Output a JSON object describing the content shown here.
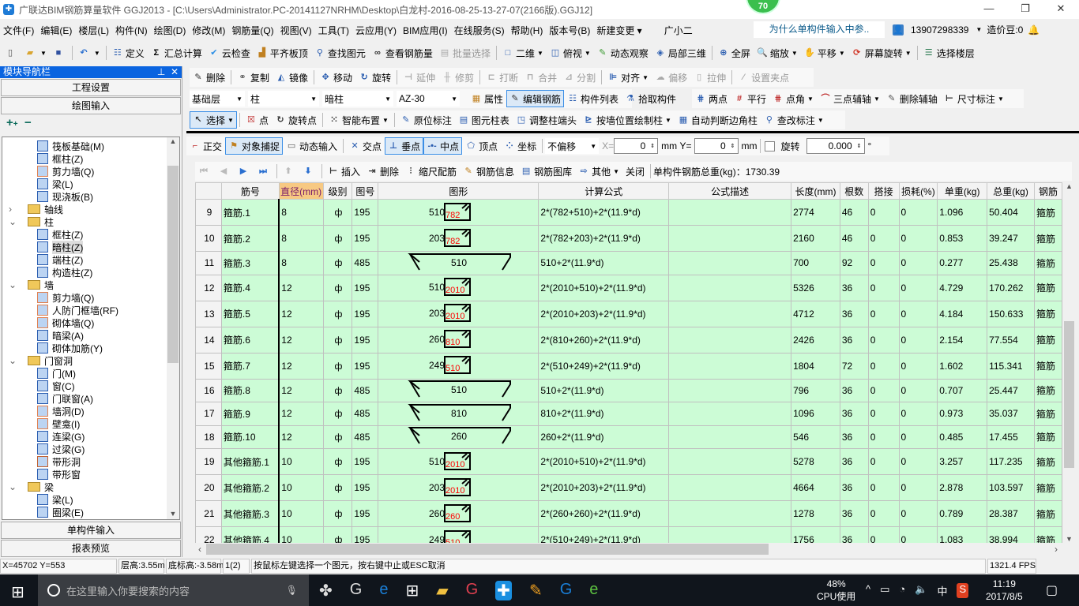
{
  "window": {
    "title": "广联达BIM钢筋算量软件 GGJ2013 - [C:\\Users\\Administrator.PC-20141127NRHM\\Desktop\\白龙村-2016-08-25-13-27-07(2166版).GGJ12]",
    "badge": "70",
    "minimize": "—",
    "restore": "❐",
    "close": "✕"
  },
  "menu": {
    "items": [
      "文件(F)",
      "编辑(E)",
      "楼层(L)",
      "构件(N)",
      "绘图(D)",
      "修改(M)",
      "钢筋量(Q)",
      "视图(V)",
      "工具(T)",
      "云应用(Y)",
      "BIM应用(I)",
      "在线服务(S)",
      "帮助(H)",
      "版本号(B)",
      "新建变更 ▾",
      "广小二"
    ],
    "question": "为什么单构件输入中参..",
    "user": "13907298339",
    "beans": "造价豆:0"
  },
  "toolbar1": [
    {
      "icon": "new-file",
      "g": "▯",
      "c": "#555"
    },
    {
      "icon": "open-folder",
      "g": "▰",
      "c": "#d9a530",
      "dd": true
    },
    {
      "icon": "save",
      "g": "■",
      "c": "#3050a0"
    },
    {
      "sep": true
    },
    {
      "icon": "undo",
      "g": "↶",
      "c": "#2a6fd0",
      "dd": true
    },
    {
      "sep": true
    },
    {
      "icon": "define",
      "g": "☷",
      "c": "#2a5db0",
      "label": "定义"
    },
    {
      "icon": "sigma",
      "g": "Σ",
      "c": "#000",
      "label": "汇总计算"
    },
    {
      "icon": "cloud-check",
      "g": "✔",
      "c": "#2a8ee6",
      "label": "云检查"
    },
    {
      "icon": "align-slab",
      "g": "▟",
      "c": "#c08020",
      "label": "平齐板顶"
    },
    {
      "icon": "binoculars",
      "g": "⚲",
      "c": "#2a5db0",
      "label": "查找图元"
    },
    {
      "icon": "glasses",
      "g": "∞",
      "c": "#333",
      "label": "查看钢筋量"
    },
    {
      "icon": "batch-select",
      "g": "▤",
      "c": "#aaa",
      "label": "批量选择",
      "dis": true
    },
    {
      "sep": true
    },
    {
      "icon": "view-2d",
      "g": "□",
      "c": "#2a5db0",
      "label": "二维",
      "dd": true
    },
    {
      "icon": "top-view",
      "g": "◫",
      "c": "#2a5db0",
      "label": "俯视",
      "dd": true
    },
    {
      "icon": "dynamic-observe",
      "g": "✎",
      "c": "#3a9a30",
      "label": "动态观察"
    },
    {
      "icon": "partial-3d",
      "g": "◈",
      "c": "#2a5db0",
      "label": "局部三维"
    },
    {
      "sep": true
    },
    {
      "icon": "fullscreen",
      "g": "⊕",
      "c": "#2a5db0",
      "label": "全屏"
    },
    {
      "icon": "zoom",
      "g": "🔍",
      "c": "#2a5db0",
      "label": "缩放",
      "dd": true
    },
    {
      "icon": "pan",
      "g": "✋",
      "c": "#c08020",
      "label": "平移",
      "dd": true
    },
    {
      "icon": "rotate-screen",
      "g": "⟳",
      "c": "#d03020",
      "label": "屏幕旋转",
      "dd": true
    },
    {
      "sep": true
    },
    {
      "icon": "select-floor",
      "g": "☰",
      "c": "#2a7a50",
      "label": "选择楼层"
    }
  ],
  "toolbar2": [
    {
      "icon": "delete",
      "g": "✎",
      "c": "#333",
      "label": "删除"
    },
    {
      "sep": true
    },
    {
      "icon": "copy",
      "g": "⚭",
      "c": "#555",
      "label": "复制"
    },
    {
      "icon": "mirror",
      "g": "◭",
      "c": "#2a5db0",
      "label": "镜像"
    },
    {
      "sep": true
    },
    {
      "icon": "move",
      "g": "✥",
      "c": "#2a5db0",
      "label": "移动"
    },
    {
      "icon": "rotate",
      "g": "↻",
      "c": "#2a5db0",
      "label": "旋转"
    },
    {
      "sep": true
    },
    {
      "icon": "extend",
      "g": "⊣",
      "c": "#aaa",
      "label": "延伸",
      "dis": true
    },
    {
      "icon": "trim",
      "g": "╫",
      "c": "#aaa",
      "label": "修剪",
      "dis": true
    },
    {
      "sep": true
    },
    {
      "icon": "break",
      "g": "⊏",
      "c": "#aaa",
      "label": "打断",
      "dis": true
    },
    {
      "icon": "merge",
      "g": "⊓",
      "c": "#aaa",
      "label": "合并",
      "dis": true
    },
    {
      "icon": "split",
      "g": "⊿",
      "c": "#aaa",
      "label": "分割",
      "dis": true
    },
    {
      "sep": true
    },
    {
      "icon": "align",
      "g": "⊫",
      "c": "#2a5db0",
      "label": "对齐",
      "dd": true
    },
    {
      "icon": "offset",
      "g": "☁",
      "c": "#aaa",
      "label": "偏移",
      "dis": true
    },
    {
      "icon": "stretch",
      "g": "▯",
      "c": "#aaa",
      "label": "拉伸",
      "dis": true
    },
    {
      "sep": true
    },
    {
      "icon": "set-grip",
      "g": "⁄",
      "c": "#aaa",
      "label": "设置夹点",
      "dis": true
    }
  ],
  "toolbar3": {
    "combos": [
      "基础层",
      "柱",
      "暗柱",
      "AZ-30"
    ],
    "items": [
      {
        "icon": "properties",
        "g": "▦",
        "c": "#c08020",
        "label": "属性"
      },
      {
        "icon": "edit-rebar",
        "g": "✎",
        "c": "#333",
        "label": "编辑钢筋",
        "active": true
      },
      {
        "icon": "component-list",
        "g": "☷",
        "c": "#2a5db0",
        "label": "构件列表"
      },
      {
        "icon": "pick-component",
        "g": "⚗",
        "c": "#2a5db0",
        "label": "拾取构件"
      }
    ]
  },
  "toolbar3b": [
    {
      "icon": "two-point-axis",
      "g": "⋕",
      "c": "#2a5db0",
      "label": "两点"
    },
    {
      "icon": "parallel-axis",
      "g": "#",
      "c": "#c03030",
      "label": "平行"
    },
    {
      "icon": "point-angle-axis",
      "g": "⋕",
      "c": "#c03030",
      "label": "点角",
      "dd": true
    },
    {
      "icon": "three-point-axis",
      "g": "⌒",
      "c": "#c03030",
      "label": "三点辅轴",
      "dd": true
    },
    {
      "icon": "delete-axis",
      "g": "✎",
      "c": "#555",
      "label": "删除辅轴"
    },
    {
      "icon": "dimension",
      "g": "⊢",
      "c": "#333",
      "label": "尺寸标注",
      "dd": true
    }
  ],
  "toolbar4": [
    {
      "icon": "select-cursor",
      "g": "↖",
      "c": "#333",
      "label": "选择",
      "active": true,
      "dd": true
    },
    {
      "sep": true
    },
    {
      "icon": "point",
      "g": "☒",
      "c": "#c03030",
      "label": "点"
    },
    {
      "icon": "rotate-point",
      "g": "↻",
      "c": "#333",
      "label": "旋转点"
    },
    {
      "sep": true
    },
    {
      "icon": "smart-layout",
      "g": "⁙",
      "c": "#333",
      "label": "智能布置",
      "dd": true
    },
    {
      "sep": true
    },
    {
      "icon": "in-situ-annotation",
      "g": "✎",
      "c": "#2a5db0",
      "label": "原位标注"
    },
    {
      "icon": "column-table",
      "g": "▤",
      "c": "#2a5db0",
      "label": "图元柱表"
    },
    {
      "icon": "adjust-column-end",
      "g": "◳",
      "c": "#2a5db0",
      "label": "调整柱端头"
    },
    {
      "icon": "draw-by-wall",
      "g": "⊵",
      "c": "#2a5db0",
      "label": "按墙位置绘制柱",
      "dd": true
    },
    {
      "icon": "auto-corner-column",
      "g": "▦",
      "c": "#2a5db0",
      "label": "自动判断边角柱"
    },
    {
      "icon": "modify-annotation",
      "g": "⚲",
      "c": "#2a5db0",
      "label": "查改标注",
      "dd": true
    }
  ],
  "toolbar5": {
    "items": [
      {
        "icon": "orthogonal",
        "g": "⌐",
        "c": "#c03030",
        "label": "正交"
      },
      {
        "icon": "object-snap",
        "g": "⚑",
        "c": "#c08020",
        "label": "对象捕捉",
        "active": true
      },
      {
        "icon": "dynamic-input",
        "g": "▭",
        "c": "#555",
        "label": "动态输入"
      },
      {
        "sep": true
      },
      {
        "icon": "intersection",
        "g": "✕",
        "c": "#2a5db0",
        "label": "交点"
      },
      {
        "icon": "perpendicular",
        "g": "⊥",
        "c": "#2a5db0",
        "label": "垂点",
        "active": true
      },
      {
        "icon": "midpoint",
        "g": "-•-",
        "c": "#2a5db0",
        "label": "中点",
        "active": true
      },
      {
        "icon": "vertex",
        "g": "⬠",
        "c": "#2a5db0",
        "label": "顶点"
      },
      {
        "icon": "coordinate",
        "g": "⁘",
        "c": "#2a5db0",
        "label": "坐标"
      }
    ],
    "offset": "不偏移",
    "x_label": "X=",
    "x_value": "0",
    "unit": "mm",
    "y_label": "Y=",
    "y_value": "0",
    "rotate_label": "旋转",
    "rotate_value": "0.000",
    "degree": "°"
  },
  "rebar_toolbar": {
    "items": [
      {
        "icon": "first",
        "g": "⏮",
        "c": "#bbb"
      },
      {
        "icon": "prev",
        "g": "◀",
        "c": "#bbb"
      },
      {
        "icon": "next",
        "g": "▶",
        "c": "#2a6fd0"
      },
      {
        "icon": "last",
        "g": "⏭",
        "c": "#2a6fd0"
      },
      {
        "sep": true
      },
      {
        "icon": "move-up",
        "g": "⬆",
        "c": "#bbb"
      },
      {
        "icon": "move-down",
        "g": "⬇",
        "c": "#2a6fd0"
      },
      {
        "sep": true
      },
      {
        "icon": "insert",
        "g": "⊢",
        "c": "#333",
        "label": "插入"
      },
      {
        "icon": "delete-row",
        "g": "⇥",
        "c": "#333",
        "label": "删除"
      },
      {
        "icon": "scale-rebar",
        "g": "⫶",
        "c": "#333",
        "label": "缩尺配筋"
      },
      {
        "icon": "rebar-info",
        "g": "✎",
        "c": "#c08020",
        "label": "钢筋信息"
      },
      {
        "icon": "rebar-library",
        "g": "▤",
        "c": "#2a5db0",
        "label": "钢筋图库"
      },
      {
        "icon": "other",
        "g": "⇨",
        "c": "#2a5db0",
        "label": "其他",
        "dd": true
      },
      {
        "label": "关闭"
      },
      {
        "sep": true
      }
    ],
    "total_label": "单构件钢筋总重(kg)：1730.39"
  },
  "nav": {
    "title": "模块导航栏",
    "pin": "⊥",
    "close": "✕",
    "top_buttons": [
      "工程设置",
      "绘图输入"
    ],
    "bottom_buttons": [
      "单构件输入",
      "报表预览"
    ],
    "expand": "+",
    "collapse": "−",
    "tree": [
      {
        "level": 2,
        "label": "筏板基础(M)",
        "icon": "raft-foundation",
        "c": "#2a5db0"
      },
      {
        "level": 2,
        "label": "框柱(Z)",
        "icon": "frame-column",
        "c": "#2a5db0"
      },
      {
        "level": 2,
        "label": "剪力墙(Q)",
        "icon": "shear-wall",
        "c": "#e08050"
      },
      {
        "level": 2,
        "label": "梁(L)",
        "icon": "beam",
        "c": "#2a5db0"
      },
      {
        "level": 2,
        "label": "现浇板(B)",
        "icon": "cast-slab",
        "c": "#2a5db0"
      },
      {
        "level": 1,
        "label": "轴线",
        "folder": true,
        "arrow": "›"
      },
      {
        "level": 1,
        "label": "柱",
        "folder": true,
        "arrow": "⌄"
      },
      {
        "level": 2,
        "label": "框柱(Z)",
        "icon": "frame-column",
        "c": "#2a5db0"
      },
      {
        "level": 2,
        "label": "暗柱(Z)",
        "icon": "hidden-column",
        "c": "#2a5db0",
        "selected": true
      },
      {
        "level": 2,
        "label": "端柱(Z)",
        "icon": "end-column",
        "c": "#2a5db0"
      },
      {
        "level": 2,
        "label": "构造柱(Z)",
        "icon": "constructional-column",
        "c": "#2a5db0"
      },
      {
        "level": 1,
        "label": "墙",
        "folder": true,
        "arrow": "⌄"
      },
      {
        "level": 2,
        "label": "剪力墙(Q)",
        "icon": "shear-wall",
        "c": "#e08050"
      },
      {
        "level": 2,
        "label": "人防门框墙(RF)",
        "icon": "civil-defense-wall",
        "c": "#e08050"
      },
      {
        "level": 2,
        "label": "砌体墙(Q)",
        "icon": "masonry-wall",
        "c": "#e08050"
      },
      {
        "level": 2,
        "label": "暗梁(A)",
        "icon": "hidden-beam",
        "c": "#2a5db0"
      },
      {
        "level": 2,
        "label": "砌体加筋(Y)",
        "icon": "masonry-rebar",
        "c": "#2a5db0"
      },
      {
        "level": 1,
        "label": "门窗洞",
        "folder": true,
        "arrow": "⌄"
      },
      {
        "level": 2,
        "label": "门(M)",
        "icon": "door",
        "c": "#2a5db0"
      },
      {
        "level": 2,
        "label": "窗(C)",
        "icon": "window",
        "c": "#2a5db0"
      },
      {
        "level": 2,
        "label": "门联窗(A)",
        "icon": "door-window",
        "c": "#2a5db0"
      },
      {
        "level": 2,
        "label": "墙洞(D)",
        "icon": "wall-hole",
        "c": "#e08050"
      },
      {
        "level": 2,
        "label": "壁龛(I)",
        "icon": "niche",
        "c": "#e08050"
      },
      {
        "level": 2,
        "label": "连梁(G)",
        "icon": "coupling-beam",
        "c": "#2a5db0"
      },
      {
        "level": 2,
        "label": "过梁(G)",
        "icon": "lintel",
        "c": "#2a5db0"
      },
      {
        "level": 2,
        "label": "带形洞",
        "icon": "strip-hole",
        "c": "#c06030"
      },
      {
        "level": 2,
        "label": "带形窗",
        "icon": "strip-window",
        "c": "#2a5db0"
      },
      {
        "level": 1,
        "label": "梁",
        "folder": true,
        "arrow": "⌄"
      },
      {
        "level": 2,
        "label": "梁(L)",
        "icon": "beam",
        "c": "#2a5db0"
      },
      {
        "level": 2,
        "label": "圈梁(E)",
        "icon": "ring-beam",
        "c": "#2a5db0"
      }
    ]
  },
  "table": {
    "headers": [
      "",
      "筋号",
      "直径(mm)",
      "级别",
      "图号",
      "图形",
      "计算公式",
      "公式描述",
      "长度(mm)",
      "根数",
      "搭接",
      "损耗(%)",
      "单重(kg)",
      "总重(kg)",
      "钢筋"
    ],
    "grade_symbol": "ф",
    "rows": [
      {
        "n": "9",
        "name": "箍筋.1",
        "d": "8",
        "fig": "195",
        "s1": "510",
        "s2": "782",
        "formula": "2*(782+510)+2*(11.9*d)",
        "len": "2774",
        "cnt": "46",
        "lap": "0",
        "loss": "0",
        "uw": "1.096",
        "tw": "50.404",
        "type": "箍筋"
      },
      {
        "n": "10",
        "name": "箍筋.2",
        "d": "8",
        "fig": "195",
        "s1": "203",
        "s2": "782",
        "formula": "2*(782+203)+2*(11.9*d)",
        "len": "2160",
        "cnt": "46",
        "lap": "0",
        "loss": "0",
        "uw": "0.853",
        "tw": "39.247",
        "type": "箍筋"
      },
      {
        "n": "11",
        "name": "箍筋.3",
        "d": "8",
        "fig": "485",
        "s1": "510",
        "formula": "510+2*(11.9*d)",
        "len": "700",
        "cnt": "92",
        "lap": "0",
        "loss": "0",
        "uw": "0.277",
        "tw": "25.438",
        "type": "箍筋"
      },
      {
        "n": "12",
        "name": "箍筋.4",
        "d": "12",
        "fig": "195",
        "s1": "510",
        "s2": "2010",
        "formula": "2*(2010+510)+2*(11.9*d)",
        "len": "5326",
        "cnt": "36",
        "lap": "0",
        "loss": "0",
        "uw": "4.729",
        "tw": "170.262",
        "type": "箍筋"
      },
      {
        "n": "13",
        "name": "箍筋.5",
        "d": "12",
        "fig": "195",
        "s1": "203",
        "s2": "2010",
        "formula": "2*(2010+203)+2*(11.9*d)",
        "len": "4712",
        "cnt": "36",
        "lap": "0",
        "loss": "0",
        "uw": "4.184",
        "tw": "150.633",
        "type": "箍筋"
      },
      {
        "n": "14",
        "name": "箍筋.6",
        "d": "12",
        "fig": "195",
        "s1": "260",
        "s2": "810",
        "formula": "2*(810+260)+2*(11.9*d)",
        "len": "2426",
        "cnt": "36",
        "lap": "0",
        "loss": "0",
        "uw": "2.154",
        "tw": "77.554",
        "type": "箍筋"
      },
      {
        "n": "15",
        "name": "箍筋.7",
        "d": "12",
        "fig": "195",
        "s1": "249",
        "s2": "510",
        "formula": "2*(510+249)+2*(11.9*d)",
        "len": "1804",
        "cnt": "72",
        "lap": "0",
        "loss": "0",
        "uw": "1.602",
        "tw": "115.341",
        "type": "箍筋"
      },
      {
        "n": "16",
        "name": "箍筋.8",
        "d": "12",
        "fig": "485",
        "s1": "510",
        "formula": "510+2*(11.9*d)",
        "len": "796",
        "cnt": "36",
        "lap": "0",
        "loss": "0",
        "uw": "0.707",
        "tw": "25.447",
        "type": "箍筋"
      },
      {
        "n": "17",
        "name": "箍筋.9",
        "d": "12",
        "fig": "485",
        "s1": "810",
        "formula": "810+2*(11.9*d)",
        "len": "1096",
        "cnt": "36",
        "lap": "0",
        "loss": "0",
        "uw": "0.973",
        "tw": "35.037",
        "type": "箍筋"
      },
      {
        "n": "18",
        "name": "箍筋.10",
        "d": "12",
        "fig": "485",
        "s1": "260",
        "formula": "260+2*(11.9*d)",
        "len": "546",
        "cnt": "36",
        "lap": "0",
        "loss": "0",
        "uw": "0.485",
        "tw": "17.455",
        "type": "箍筋"
      },
      {
        "n": "19",
        "name": "其他箍筋.1",
        "d": "10",
        "fig": "195",
        "s1": "510",
        "s2": "2010",
        "formula": "2*(2010+510)+2*(11.9*d)",
        "len": "5278",
        "cnt": "36",
        "lap": "0",
        "loss": "0",
        "uw": "3.257",
        "tw": "117.235",
        "type": "箍筋"
      },
      {
        "n": "20",
        "name": "其他箍筋.2",
        "d": "10",
        "fig": "195",
        "s1": "203",
        "s2": "2010",
        "formula": "2*(2010+203)+2*(11.9*d)",
        "len": "4664",
        "cnt": "36",
        "lap": "0",
        "loss": "0",
        "uw": "2.878",
        "tw": "103.597",
        "type": "箍筋"
      },
      {
        "n": "21",
        "name": "其他箍筋.3",
        "d": "10",
        "fig": "195",
        "s1": "260",
        "s2": "260",
        "formula": "2*(260+260)+2*(11.9*d)",
        "len": "1278",
        "cnt": "36",
        "lap": "0",
        "loss": "0",
        "uw": "0.789",
        "tw": "28.387",
        "type": "箍筋"
      },
      {
        "n": "22",
        "name": "其他箍筋.4",
        "d": "10",
        "fig": "195",
        "s1": "249",
        "s2": "510",
        "formula": "2*(510+249)+2*(11.9*d)",
        "len": "1756",
        "cnt": "36",
        "lap": "0",
        "loss": "0",
        "uw": "1.083",
        "tw": "38.994",
        "type": "箍筋"
      }
    ]
  },
  "status": {
    "coords": "X=45702 Y=553",
    "floor_height": "层高:3.55m",
    "base_elev": "底标高:-3.58m",
    "count": "1(2)",
    "hint": "按鼠标左键选择一个图元，按右键中止或ESC取消",
    "fps": "1321.4 FPS"
  },
  "taskbar": {
    "search_placeholder": "在这里输入你要搜索的内容",
    "cpu": "48%",
    "cpu_label": "CPU使用",
    "ime": "中",
    "time": "11:19",
    "date": "2017/8/5"
  },
  "colors": {
    "grid_bg": "#ccfcd6",
    "accent": "#0a64e0",
    "highlight_header": "#f7c983",
    "shape_red": "#ff0000"
  }
}
